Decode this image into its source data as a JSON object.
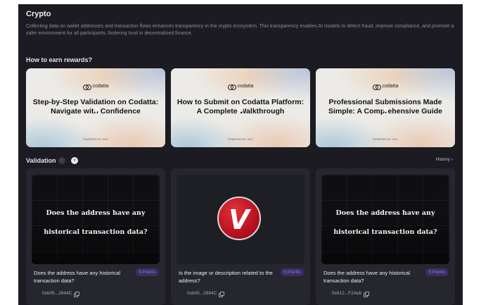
{
  "header": {
    "title": "Crypto",
    "description": "Collecting data on wallet addresses and transaction flows enhances transparency in the crypto ecosystem. This transparency enables AI models to detect fraud, improve compliance, and promote a safer environment for all participants, fostering trust in decentralized finance."
  },
  "rewards": {
    "title": "How to earn rewards?",
    "brand": "codatta",
    "powered": "POWERED BY XNY",
    "guides": [
      {
        "title": "Step-by-Step Validation on Codatta: Navigate with Confidence"
      },
      {
        "title": "How to Submit on Codatta Platform: A Complete Walkthrough"
      },
      {
        "title": "Professional Submissions Made Simple: A Comprehensive Guide"
      }
    ]
  },
  "validation": {
    "title": "Validation",
    "prev_icon": "chevron-left-icon",
    "next_icon": "chevron-right-icon",
    "history_label": "History",
    "cards": [
      {
        "image_text_1": "Does the address have any",
        "image_text_2": "historical transaction data?",
        "question": "Does the address have any historical transaction data?",
        "points": "5 Points",
        "address": "0xb05...2944C"
      },
      {
        "logo_letter": "V",
        "question": "Is the image or description related to the address?",
        "points": "5 Points",
        "address": "0xb05...2944C"
      },
      {
        "image_text_1": "Does the address have any",
        "image_text_2": "historical transaction data?",
        "question": "Does the address have any historical transaction data?",
        "points": "5 Points",
        "address": "0x812...F2Aeb"
      }
    ]
  },
  "colors": {
    "background": "#1b1b21",
    "card": "#26262e",
    "points_badge": "#3b2f63",
    "points_text": "#8f7ad8",
    "logo_red": "#c8141f"
  }
}
